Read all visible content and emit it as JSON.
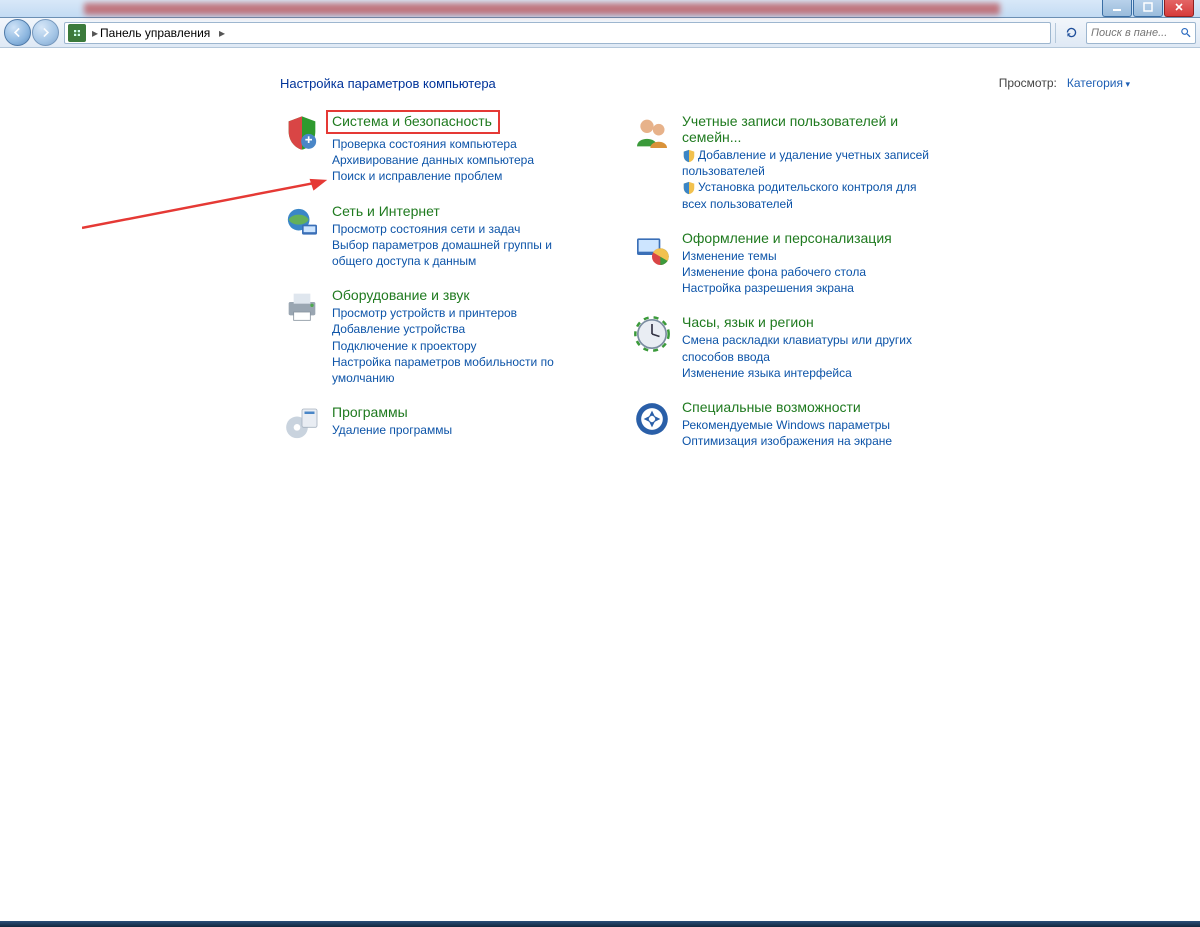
{
  "breadcrumb": {
    "label": "Панель управления"
  },
  "search": {
    "placeholder": "Поиск в пане..."
  },
  "heading": "Настройка параметров компьютера",
  "viewby": {
    "label": "Просмотр:",
    "value": "Категория"
  },
  "left": [
    {
      "title": "Система и безопасность",
      "items": [
        "Проверка состояния компьютера",
        "Архивирование данных компьютера",
        "Поиск и исправление проблем"
      ],
      "highlight": true
    },
    {
      "title": "Сеть и Интернет",
      "items": [
        "Просмотр состояния сети и задач",
        "Выбор параметров домашней группы и общего доступа к данным"
      ]
    },
    {
      "title": "Оборудование и звук",
      "items": [
        "Просмотр устройств и принтеров",
        "Добавление устройства",
        "Подключение к проектору",
        "Настройка параметров мобильности по умолчанию"
      ]
    },
    {
      "title": "Программы",
      "items": [
        "Удаление программы"
      ]
    }
  ],
  "right": [
    {
      "title": "Учетные записи пользователей и семейн...",
      "mini_items": [
        "Добавление и удаление учетных записей пользователей",
        "Установка родительского контроля для всех пользователей"
      ]
    },
    {
      "title": "Оформление и персонализация",
      "items": [
        "Изменение темы",
        "Изменение фона рабочего стола",
        "Настройка разрешения экрана"
      ]
    },
    {
      "title": "Часы, язык и регион",
      "items": [
        "Смена раскладки клавиатуры или других способов ввода",
        "Изменение языка интерфейса"
      ]
    },
    {
      "title": "Специальные возможности",
      "items": [
        "Рекомендуемые Windows параметры",
        "Оптимизация изображения на экране"
      ]
    }
  ]
}
